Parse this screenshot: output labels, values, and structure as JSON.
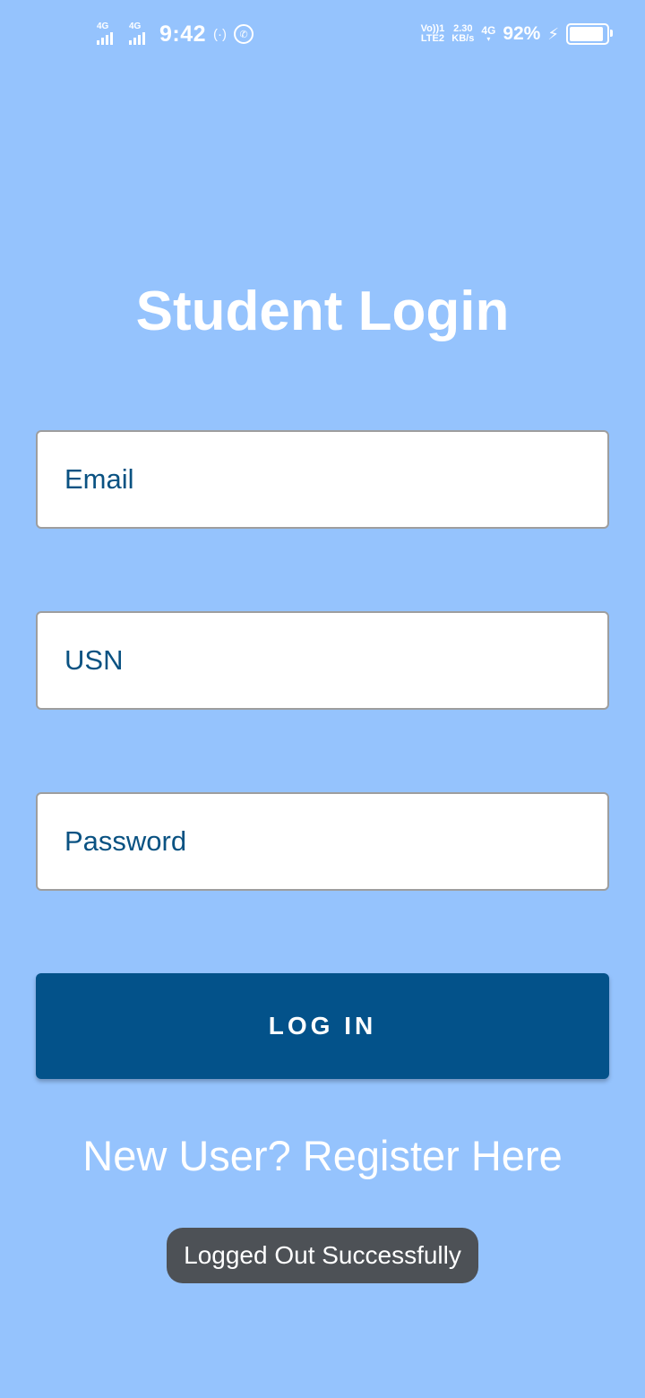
{
  "status_bar": {
    "sim1_label": "4G",
    "sim2_label": "4G",
    "time": "9:42",
    "hotspot_icon": "(·)",
    "whatsapp_icon": "whatsapp-icon",
    "volte_top": "Vo))1",
    "volte_bottom": "LTE2",
    "speed_value": "2.30",
    "speed_unit": "KB/s",
    "net_type": "4G",
    "battery_percent": "92%",
    "battery_level": 0.92,
    "charging_icon": "⚡"
  },
  "page": {
    "title": "Student Login"
  },
  "form": {
    "email_placeholder": "Email",
    "usn_placeholder": "USN",
    "password_placeholder": "Password",
    "login_label": "LOG IN"
  },
  "links": {
    "register": "New User? Register Here"
  },
  "toast": {
    "message": "Logged Out Successfully"
  },
  "colors": {
    "background": "#95c3fd",
    "button": "#03528a",
    "input_text": "#06507f",
    "toast_bg": "#4d5156"
  }
}
